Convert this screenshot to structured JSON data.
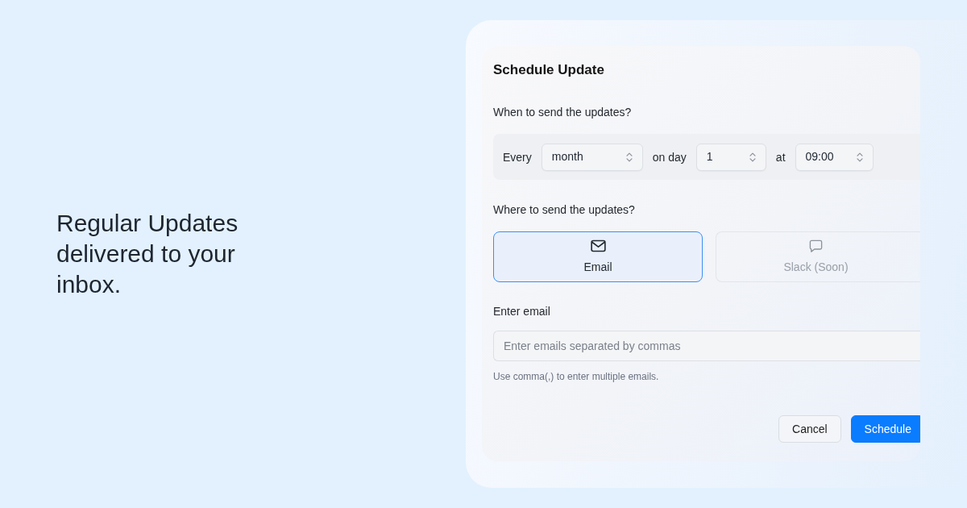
{
  "headline": "Regular Updates delivered to your inbox.",
  "dialog": {
    "title": "Schedule Update",
    "schedule": {
      "label": "When to send the updates?",
      "row": [
        {
          "kind": "text",
          "text": "Every"
        },
        {
          "kind": "select",
          "value": "month"
        },
        {
          "kind": "text",
          "text": "on day"
        },
        {
          "kind": "select",
          "value": "1"
        },
        {
          "kind": "text",
          "text": "at"
        },
        {
          "kind": "select",
          "value": "09:00"
        }
      ]
    },
    "destination": {
      "label": "Where to send the updates?",
      "options": [
        {
          "kind": "mail",
          "label": "Email",
          "selected": true,
          "disabled": false
        },
        {
          "kind": "chat",
          "label": "Slack (Soon)",
          "selected": false,
          "disabled": true
        }
      ]
    },
    "email_field": {
      "label": "Enter email",
      "placeholder": "Enter emails separated by commas",
      "hint": "Use comma(,) to enter multiple emails."
    },
    "buttons": [
      {
        "kind": "cancel",
        "label": "Cancel"
      },
      {
        "kind": "submit",
        "label": "Schedule"
      }
    ]
  }
}
